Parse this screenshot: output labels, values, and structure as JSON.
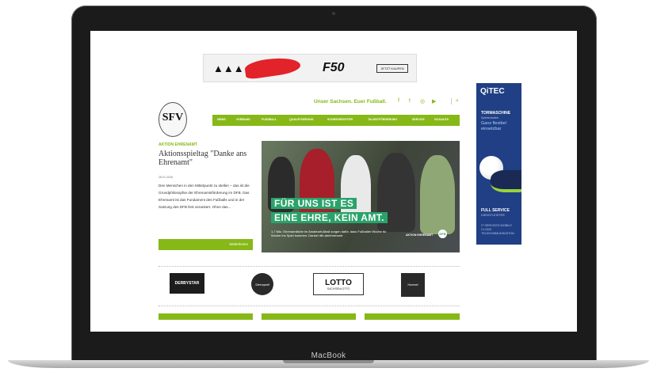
{
  "device": {
    "label": "MacBook"
  },
  "ad_banner": {
    "brand": "adidas",
    "product": "F50",
    "cta": "JETZT KAUFEN"
  },
  "header": {
    "tagline": "Unser Sachsen. Euer Fußball.",
    "social_icons": [
      "facebook-icon",
      "twitter-icon",
      "instagram-icon",
      "youtube-icon",
      "search-icon"
    ],
    "social_glyphs": [
      "f",
      "t",
      "◎",
      "▶",
      "⌕"
    ],
    "logo_text": "SFV"
  },
  "nav": {
    "items": [
      "NEWS",
      "VERBAND",
      "FUSSBALL",
      "QUALIFIZIERUNG",
      "SCHIEDSRICHTER",
      "TALENTFÖRDERUNG",
      "SERVICE",
      "SOZIALES"
    ]
  },
  "article": {
    "kicker": "AKTION EHRENAMT",
    "headline": "Aktionsspieltag \"Danke ans Ehrenamt\"",
    "date": "28.01.2026",
    "teaser": "Den Menschen in den Mittelpunkt zu stellen – das ist die Grundphilosophie der Ehrenamtsförderung im DFB. Das Ehrenamt ist das Fundament des Fußballs und in der Satzung des DFB fest verankert. Ohne das...",
    "more_label": "Weiterlesen"
  },
  "hero": {
    "line1": "FÜR UNS IST ES",
    "line2": "EINE EHRE, KEIN AMT.",
    "sub": "1,7 Mio. Ehrenamtliche im Amateurfußball sorgen dafür, dass Fußballer Woche für Woche ins Spiel kommen. Danke! dfb.de/ehrenamt",
    "brand": "AKTION EHRENAMT",
    "badge": "DFB"
  },
  "sponsors": [
    {
      "name": "DERBYSTAR"
    },
    {
      "name": "Sternquell"
    },
    {
      "name": "LOTTO",
      "sub": "SACHSENLOTTO"
    },
    {
      "name": "Hummel"
    }
  ],
  "side_ad": {
    "brand": "QiTEC",
    "title": "TORMASCHINE",
    "kicker": "Spielerlaufen",
    "big": "Ganz flexibel einsetzbar",
    "service": "FULL SERVICE",
    "service_sub": "DIENSTLEISTER",
    "fine": "IT SERVICES MOBILE CLOUD TELEKOMMUNIKATION"
  },
  "colors": {
    "accent": "#86b817",
    "hero_green": "#2aa36b",
    "side_ad_bg": "#203f84"
  }
}
